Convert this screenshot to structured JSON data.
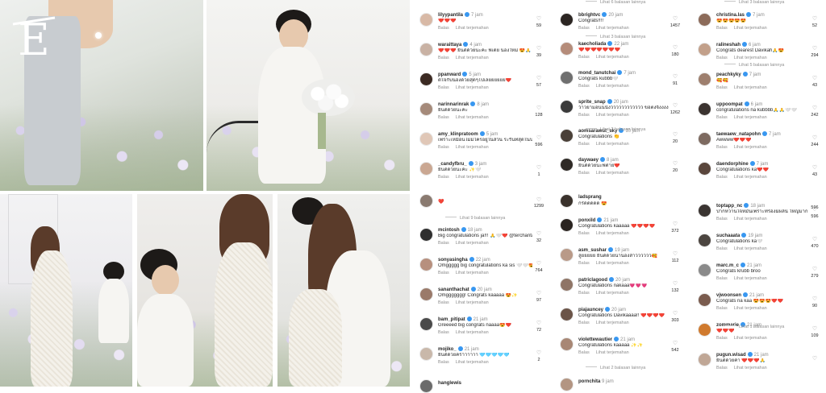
{
  "brand": {
    "logo_letter": "E"
  },
  "comments": {
    "colA": [
      {
        "user": "lilyypantila",
        "time": "7 jam",
        "text": "❤️❤️❤️",
        "likes": "59",
        "reply": "Balas",
        "translate": "Lihat terjemahan",
        "av": "#d8b9a6"
      },
      {
        "user": "waraittaya",
        "time": "4 jam",
        "text": "❤️❤️❤️ ยินดีด้วยนะคะ พี่เต้ย น้องใหม่ 😍🙏",
        "likes": "39",
        "reply": "Balas",
        "translate": "Lihat terjemahan",
        "av": "#c9b2a4"
      },
      {
        "user": "ppanward",
        "time": "5 jam",
        "text": "ดีใจกับน้องด้วยสุดๆไปเลยยยยยย❤️",
        "likes": "57",
        "reply": "Balas",
        "translate": "Lihat terjemahan",
        "av": "#3b2a22"
      },
      {
        "user": "narinnarinrak",
        "time": "8 jam",
        "text": "ยินดีด้วยนะคะ",
        "likes": "128",
        "reply": "Balas",
        "translate": "Lihat terjemahan",
        "av": "#a58a7a"
      },
      {
        "user": "amy_klinpratoom",
        "time": "5 jam",
        "text": "เพราะเหมือนไม่มีใครอยู่ในสวน ระริ่นที่สุดในบรู๊ดดี 😂",
        "likes": "596",
        "reply": "Balas",
        "translate": "Lihat terjemahan",
        "av": "#e0c7b7"
      },
      {
        "user": "_candyfbru_",
        "time": "3 jam",
        "text": "ยินดีด้วยนะคะ ✨🤍",
        "likes": "1",
        "reply": "Balas",
        "translate": "Lihat terjemahan",
        "av": "#caa792"
      }
    ],
    "colB": [
      {
        "user": "bbrightvc",
        "time": "20 jam",
        "text": "Congrats!!!!",
        "likes": "1457",
        "reply": "Balas",
        "translate": "Lihat terjemahan",
        "av": "#2b2522"
      },
      {
        "user": "kaecholiada",
        "time": "22 jam",
        "text": "❤️❤️❤️❤️❤️❤️❤️",
        "likes": "180",
        "reply": "Balas",
        "translate": "Lihat terjemahan",
        "av": "#b58c7a"
      },
      {
        "user": "mond_tanutchai",
        "time": "7 jam",
        "text": "Congrats kubbb🤍",
        "likes": "91",
        "reply": "Balas",
        "translate": "Lihat terjemahan",
        "av": "#6f6f6f"
      },
      {
        "user": "sprite_snap",
        "time": "20 jam",
        "text": "ว้าวยามอนนนั่งวววววววววววว ขอตงจิงงงงงง",
        "likes": "1262",
        "reply": "Balas",
        "translate": "Lihat terjemahan",
        "av": "#3a3a3a"
      },
      {
        "user": "aomsarawut_sky",
        "time": "10 jam",
        "text": "Congratulations 👏",
        "likes": "20",
        "reply": "Balas",
        "translate": "Lihat terjemahan",
        "av": "#4a4038"
      },
      {
        "user": "daywaey",
        "time": "8 jam",
        "text": "ยินดีด้วยนะพี่ต่าย❤️",
        "likes": "20",
        "reply": "Balas",
        "translate": "Lihat terjemahan",
        "av": "#2f2a26"
      }
    ],
    "colC": [
      {
        "user": "christina.las",
        "time": "7 jam",
        "text": "😍😍😍😍😍",
        "likes": "52",
        "reply": "Balas",
        "translate": "Lihat terjemahan",
        "av": "#8c6b5a"
      },
      {
        "user": "ralineshah",
        "time": "6 jam",
        "text": "Congrats dearest Davikah🙏😍",
        "likes": "294",
        "reply": "Balas",
        "translate": "Lihat terjemahan",
        "av": "#c2a08a"
      },
      {
        "user": "peachkyky",
        "time": "7 jam",
        "text": "🥰🥰",
        "likes": "43",
        "reply": "Balas",
        "translate": "Lihat terjemahan",
        "av": "#9e7f6e"
      },
      {
        "user": "uppoompat",
        "time": "6 jam",
        "text": "congratulations na kubbbb🙏🙏🤍🤍",
        "likes": "242",
        "reply": "Balas",
        "translate": "Lihat terjemahan",
        "av": "#3b3330"
      },
      {
        "user": "taewaew_natapohn",
        "time": "7 jam",
        "text": "Awwww❤️❤️❤️",
        "likes": "244",
        "reply": "Balas",
        "translate": "Lihat terjemahan",
        "av": "#7d6a60"
      },
      {
        "user": "daendorphine",
        "time": "7 jam",
        "text": "Congratulations ka❤️❤️",
        "likes": "43",
        "reply": "Balas",
        "translate": "Lihat terjemahan",
        "av": "#5a463c"
      }
    ],
    "colD": [
      {
        "user": "mcintosh",
        "time": "18 jam",
        "text": "Big congratulations ja!!! 🙏🤍❤️ @terchantavit @davikah",
        "likes": "32",
        "reply": "Balas",
        "translate": "Lihat terjemahan",
        "av": "#2f2f2f"
      },
      {
        "user": "sonyasingha",
        "time": "22 jam",
        "text": "Omggggg big congratulations ka sis 🤍🤍😍😍🙏🙏",
        "likes": "764",
        "reply": "Balas",
        "translate": "Lihat terjemahan",
        "av": "#b7907e"
      },
      {
        "user": "sananthachat",
        "time": "20 jam",
        "text": "Omggggggg! Congrats kaaaaa 😍✨",
        "likes": "97",
        "reply": "Balas",
        "translate": "Lihat terjemahan",
        "av": "#9a7a6a"
      },
      {
        "user": "bam_pitipat",
        "time": "21 jam",
        "text": "Greeeed big congrats naaaa😍❤️",
        "likes": "72",
        "reply": "Balas",
        "translate": "Lihat terjemahan",
        "av": "#4a4a4a"
      },
      {
        "user": "mojiko_",
        "time": "21 jam",
        "text": "ยินดีด้วยคร้าาาาาา 🩵🩵🩵🩵🩵",
        "likes": "2",
        "reply": "Balas",
        "translate": "Lihat terjemahan",
        "av": "#c9b8aa"
      }
    ],
    "colE": [
      {
        "user": "ponxild",
        "time": "21 jam",
        "text": "Congratulations kaaaaa ❤️❤️❤️❤️",
        "likes": "372",
        "reply": "Balas",
        "translate": "Lihat terjemahan",
        "av": "#2a2420"
      },
      {
        "user": "asm_sushar",
        "time": "19 jam",
        "text": "ลู่ยยยยย ยินดีด้วยน้าน้องสาวววววว🥰",
        "likes": "112",
        "reply": "Balas",
        "translate": "Lihat terjemahan",
        "av": "#b99a88"
      },
      {
        "user": "patriclagood",
        "time": "20 jam",
        "text": "Congratulations nakaaa💗💗💗",
        "likes": "132",
        "reply": "Balas",
        "translate": "Lihat terjemahan",
        "av": "#8f7566"
      },
      {
        "user": "piajauncey",
        "time": "20 jam",
        "text": "Congratulations Davikaaaa!! ❤️❤️❤️❤️",
        "likes": "303",
        "reply": "Balas",
        "translate": "Lihat terjemahan",
        "av": "#6b5448"
      },
      {
        "user": "violettewautier",
        "time": "21 jam",
        "text": "Congratulations kaaaaa ✨✨",
        "likes": "542",
        "reply": "Balas",
        "translate": "Lihat terjemahan",
        "av": "#a88775"
      }
    ],
    "colF": [
      {
        "user": "toptapp_nc",
        "time": "18 jam",
        "text": "ปากหวานใจหมั่นเพราะที่ร้องมีผลีนี้ ใหญ่มาก หน่วยกาาาาาาาวท์ ❤️ นาน์",
        "likes": "596",
        "reply": "Balas",
        "translate": "Lihat terjemahan",
        "av": "#3a3431"
      },
      {
        "user": "suchaaata",
        "time": "19 jam",
        "text": "Congratulations ka🤍",
        "likes": "470",
        "reply": "Balas",
        "translate": "Lihat terjemahan",
        "av": "#4c4540"
      },
      {
        "user": "marc.m_c",
        "time": "21 jam",
        "text": "Congrats krubb broo",
        "likes": "279",
        "reply": "Balas",
        "translate": "Lihat terjemahan",
        "av": "#8a8a8a"
      },
      {
        "user": "vjwoonsen",
        "time": "21 jam",
        "text": "Congrats na kaa 😍😍😍❤️❤️",
        "likes": "90",
        "reply": "Balas",
        "translate": "Lihat terjemahan",
        "av": "#7a5c4e"
      },
      {
        "user": "zommarie",
        "time": "21 jam",
        "text": "❤️❤️❤️",
        "likes": "109",
        "reply": "Balas",
        "translate": "Lihat terjemahan",
        "av": "#d07a2e"
      },
      {
        "user": "pugun.wisad",
        "time": "21 jam",
        "text": "ยินดีด้วยค่า ❤️❤️❤️🙏",
        "likes": "",
        "reply": "Balas",
        "translate": "Lihat terjemahan",
        "av": "#c0a796"
      }
    ]
  },
  "more_replies": {
    "colA": "Lihat 5 balasan lainnya",
    "colA_bottom": "Lihat 9 balasan lainnya",
    "colB_top": "Lihat 6 balasan lainnya",
    "colB1": "Lihat 3 balasan lainnya",
    "colB2": "Lihat 2 balasan lainnya",
    "colC_top": "Lihat 3 balasan lainnya",
    "colC1": "Lihat 5 balasan lainnya",
    "colE1": "Lihat 2 balasan lainnya",
    "colF1": "Lihat 1 balasan lainnya"
  },
  "partial": {
    "colD_top_likes": "1299",
    "colE_top": "ladsprang",
    "colE_top_text": "กรี๊ดดดดด 😍",
    "colD_bottom_user": "hanglewis",
    "colE_bottom_user": "pornchita",
    "colE_bottom_time": "9 jam",
    "colF_top_likes": "596"
  }
}
